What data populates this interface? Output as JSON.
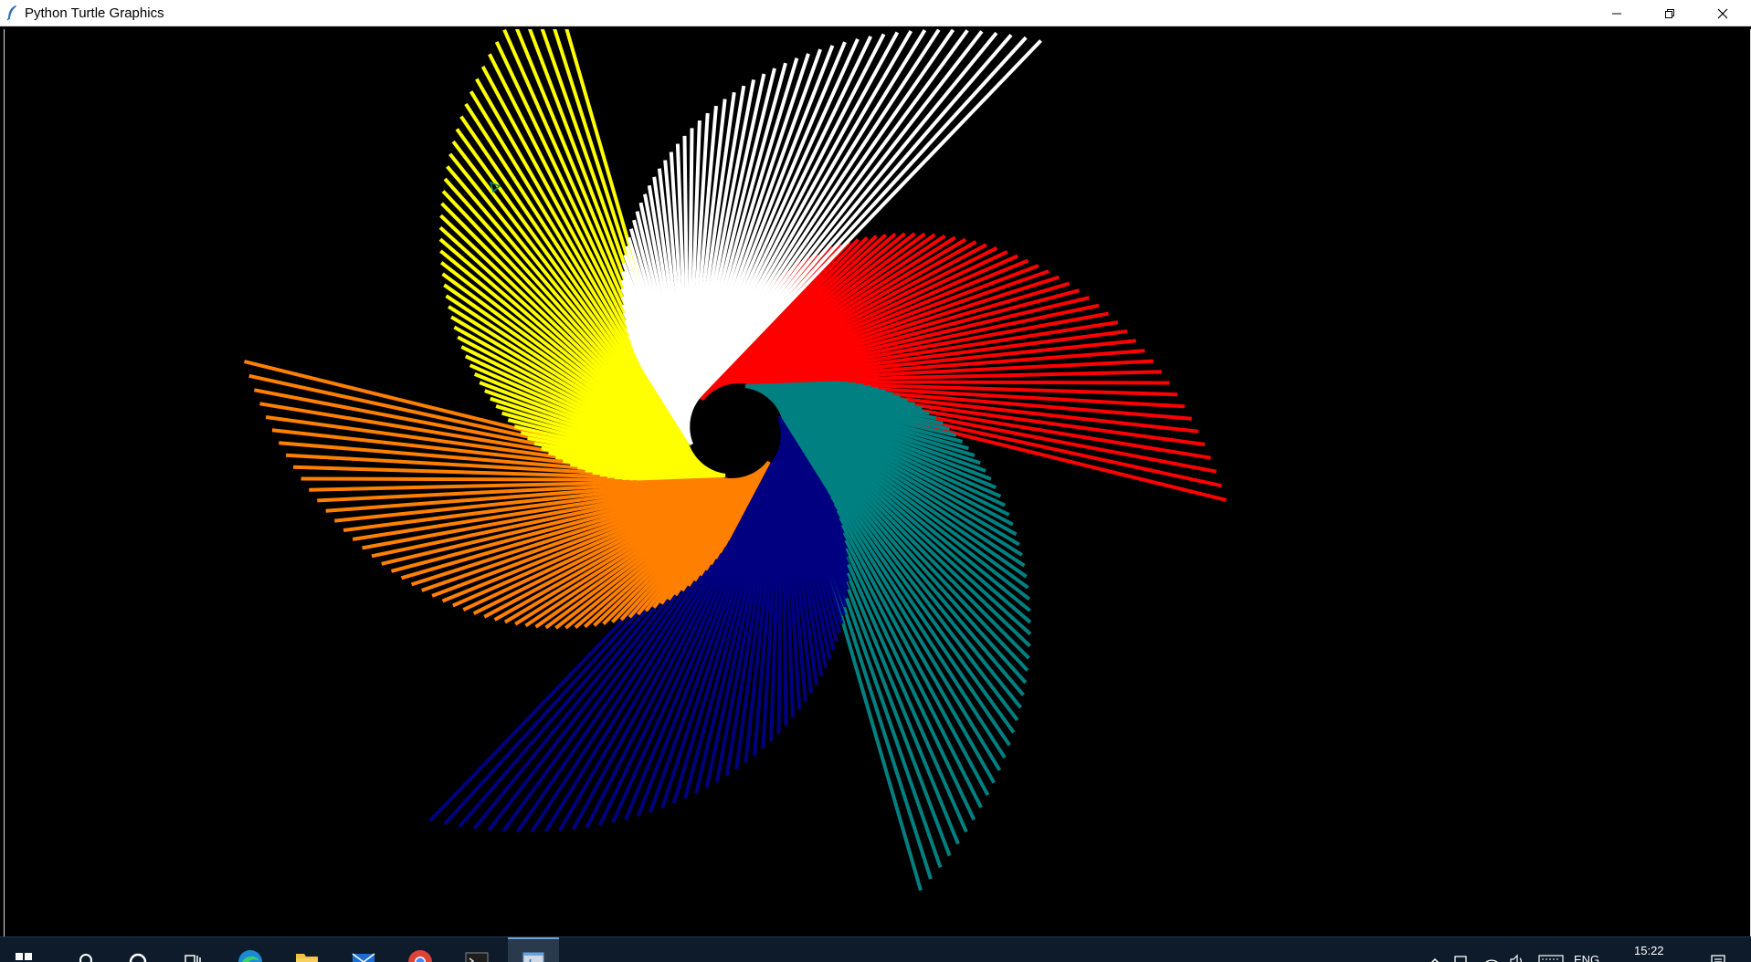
{
  "window": {
    "title": "Python Turtle Graphics",
    "app_icon": "python-feather-icon",
    "controls": {
      "minimize_icon": "minimize-icon",
      "maximize_icon": "restore-icon",
      "close_icon": "close-icon"
    }
  },
  "canvas": {
    "background": "#000000",
    "drawing": {
      "shape": "hexagonal spiral",
      "colors": [
        "#ff0000",
        "#008080",
        "#000080",
        "#ff8000",
        "#ffff00",
        "#ffffff"
      ],
      "color_names": [
        "red",
        "teal",
        "navy",
        "orange",
        "yellow",
        "white"
      ]
    }
  },
  "taskbar": {
    "apps": [
      {
        "icon": "windows-start-icon"
      },
      {
        "icon": "search-icon"
      },
      {
        "icon": "cortana-icon"
      },
      {
        "icon": "task-view-icon"
      },
      {
        "icon": "edge-browser-icon"
      },
      {
        "icon": "file-explorer-icon"
      },
      {
        "icon": "mail-icon"
      },
      {
        "icon": "chrome-icon"
      },
      {
        "icon": "terminal-icon"
      },
      {
        "icon": "python-turtle-app-icon",
        "active": true
      }
    ],
    "tray": {
      "language": "ENG",
      "time": "15:22",
      "icons": [
        "chevron-up-icon",
        "network-icon",
        "wifi-icon",
        "volume-icon",
        "keyboard-icon",
        "notifications-icon"
      ]
    }
  }
}
